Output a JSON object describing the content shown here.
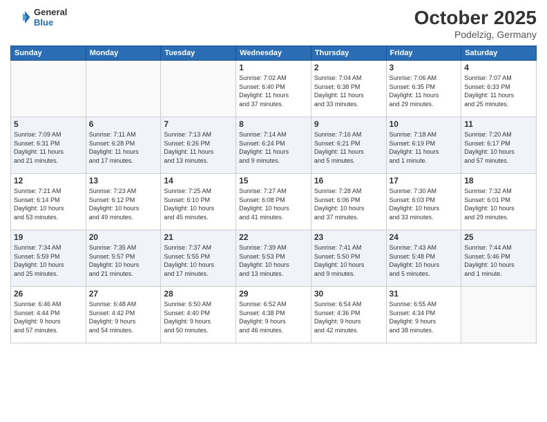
{
  "header": {
    "logo_line1": "General",
    "logo_line2": "Blue",
    "month": "October 2025",
    "location": "Podelzig, Germany"
  },
  "weekdays": [
    "Sunday",
    "Monday",
    "Tuesday",
    "Wednesday",
    "Thursday",
    "Friday",
    "Saturday"
  ],
  "weeks": [
    {
      "alt": false,
      "days": [
        {
          "num": "",
          "info": ""
        },
        {
          "num": "",
          "info": ""
        },
        {
          "num": "",
          "info": ""
        },
        {
          "num": "1",
          "info": "Sunrise: 7:02 AM\nSunset: 6:40 PM\nDaylight: 11 hours\nand 37 minutes."
        },
        {
          "num": "2",
          "info": "Sunrise: 7:04 AM\nSunset: 6:38 PM\nDaylight: 11 hours\nand 33 minutes."
        },
        {
          "num": "3",
          "info": "Sunrise: 7:06 AM\nSunset: 6:35 PM\nDaylight: 11 hours\nand 29 minutes."
        },
        {
          "num": "4",
          "info": "Sunrise: 7:07 AM\nSunset: 6:33 PM\nDaylight: 11 hours\nand 25 minutes."
        }
      ]
    },
    {
      "alt": true,
      "days": [
        {
          "num": "5",
          "info": "Sunrise: 7:09 AM\nSunset: 6:31 PM\nDaylight: 11 hours\nand 21 minutes."
        },
        {
          "num": "6",
          "info": "Sunrise: 7:11 AM\nSunset: 6:28 PM\nDaylight: 11 hours\nand 17 minutes."
        },
        {
          "num": "7",
          "info": "Sunrise: 7:13 AM\nSunset: 6:26 PM\nDaylight: 11 hours\nand 13 minutes."
        },
        {
          "num": "8",
          "info": "Sunrise: 7:14 AM\nSunset: 6:24 PM\nDaylight: 11 hours\nand 9 minutes."
        },
        {
          "num": "9",
          "info": "Sunrise: 7:16 AM\nSunset: 6:21 PM\nDaylight: 11 hours\nand 5 minutes."
        },
        {
          "num": "10",
          "info": "Sunrise: 7:18 AM\nSunset: 6:19 PM\nDaylight: 11 hours\nand 1 minute."
        },
        {
          "num": "11",
          "info": "Sunrise: 7:20 AM\nSunset: 6:17 PM\nDaylight: 10 hours\nand 57 minutes."
        }
      ]
    },
    {
      "alt": false,
      "days": [
        {
          "num": "12",
          "info": "Sunrise: 7:21 AM\nSunset: 6:14 PM\nDaylight: 10 hours\nand 53 minutes."
        },
        {
          "num": "13",
          "info": "Sunrise: 7:23 AM\nSunset: 6:12 PM\nDaylight: 10 hours\nand 49 minutes."
        },
        {
          "num": "14",
          "info": "Sunrise: 7:25 AM\nSunset: 6:10 PM\nDaylight: 10 hours\nand 45 minutes."
        },
        {
          "num": "15",
          "info": "Sunrise: 7:27 AM\nSunset: 6:08 PM\nDaylight: 10 hours\nand 41 minutes."
        },
        {
          "num": "16",
          "info": "Sunrise: 7:28 AM\nSunset: 6:06 PM\nDaylight: 10 hours\nand 37 minutes."
        },
        {
          "num": "17",
          "info": "Sunrise: 7:30 AM\nSunset: 6:03 PM\nDaylight: 10 hours\nand 33 minutes."
        },
        {
          "num": "18",
          "info": "Sunrise: 7:32 AM\nSunset: 6:01 PM\nDaylight: 10 hours\nand 29 minutes."
        }
      ]
    },
    {
      "alt": true,
      "days": [
        {
          "num": "19",
          "info": "Sunrise: 7:34 AM\nSunset: 5:59 PM\nDaylight: 10 hours\nand 25 minutes."
        },
        {
          "num": "20",
          "info": "Sunrise: 7:35 AM\nSunset: 5:57 PM\nDaylight: 10 hours\nand 21 minutes."
        },
        {
          "num": "21",
          "info": "Sunrise: 7:37 AM\nSunset: 5:55 PM\nDaylight: 10 hours\nand 17 minutes."
        },
        {
          "num": "22",
          "info": "Sunrise: 7:39 AM\nSunset: 5:53 PM\nDaylight: 10 hours\nand 13 minutes."
        },
        {
          "num": "23",
          "info": "Sunrise: 7:41 AM\nSunset: 5:50 PM\nDaylight: 10 hours\nand 9 minutes."
        },
        {
          "num": "24",
          "info": "Sunrise: 7:43 AM\nSunset: 5:48 PM\nDaylight: 10 hours\nand 5 minutes."
        },
        {
          "num": "25",
          "info": "Sunrise: 7:44 AM\nSunset: 5:46 PM\nDaylight: 10 hours\nand 1 minute."
        }
      ]
    },
    {
      "alt": false,
      "days": [
        {
          "num": "26",
          "info": "Sunrise: 6:46 AM\nSunset: 4:44 PM\nDaylight: 9 hours\nand 57 minutes."
        },
        {
          "num": "27",
          "info": "Sunrise: 6:48 AM\nSunset: 4:42 PM\nDaylight: 9 hours\nand 54 minutes."
        },
        {
          "num": "28",
          "info": "Sunrise: 6:50 AM\nSunset: 4:40 PM\nDaylight: 9 hours\nand 50 minutes."
        },
        {
          "num": "29",
          "info": "Sunrise: 6:52 AM\nSunset: 4:38 PM\nDaylight: 9 hours\nand 46 minutes."
        },
        {
          "num": "30",
          "info": "Sunrise: 6:54 AM\nSunset: 4:36 PM\nDaylight: 9 hours\nand 42 minutes."
        },
        {
          "num": "31",
          "info": "Sunrise: 6:55 AM\nSunset: 4:34 PM\nDaylight: 9 hours\nand 38 minutes."
        },
        {
          "num": "",
          "info": ""
        }
      ]
    }
  ]
}
